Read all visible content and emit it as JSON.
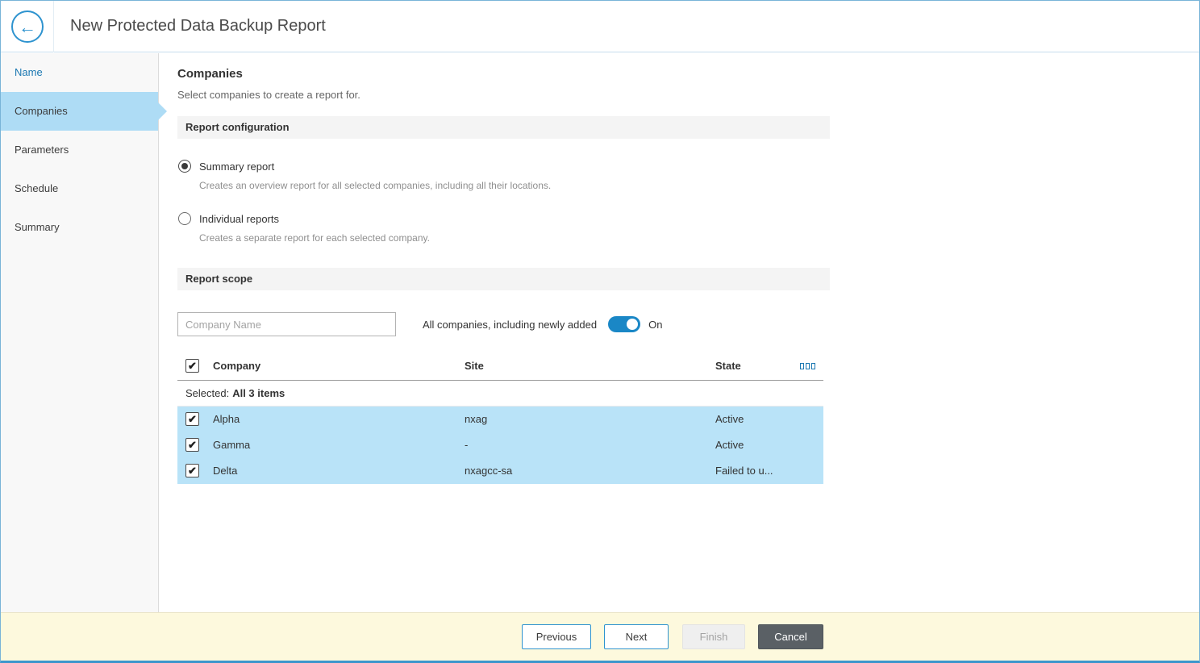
{
  "header": {
    "title": "New Protected Data Backup Report"
  },
  "sidebar": {
    "items": [
      {
        "label": "Name"
      },
      {
        "label": "Companies"
      },
      {
        "label": "Parameters"
      },
      {
        "label": "Schedule"
      },
      {
        "label": "Summary"
      }
    ]
  },
  "main": {
    "title": "Companies",
    "subtitle": "Select companies to create a report for.",
    "report_configuration": {
      "heading": "Report configuration",
      "options": [
        {
          "label": "Summary report",
          "description": "Creates an overview report for all selected companies, including all their locations.",
          "selected": true
        },
        {
          "label": "Individual reports",
          "description": "Creates a separate report for each selected company.",
          "selected": false
        }
      ]
    },
    "report_scope": {
      "heading": "Report scope",
      "filter_placeholder": "Company Name",
      "toggle_label": "All companies, including newly added",
      "toggle_state_label": "On",
      "table": {
        "columns": {
          "company": "Company",
          "site": "Site",
          "state": "State"
        },
        "selected_prefix": "Selected:",
        "selected_value": "All 3 items",
        "rows": [
          {
            "company": "Alpha",
            "site": "nxag",
            "state": "Active",
            "checked": true
          },
          {
            "company": "Gamma",
            "site": "-",
            "state": "Active",
            "checked": true
          },
          {
            "company": "Delta",
            "site": "nxagcc-sa",
            "state": "Failed to u...",
            "checked": true
          }
        ]
      }
    }
  },
  "footer": {
    "previous_label": "Previous",
    "next_label": "Next",
    "finish_label": "Finish",
    "cancel_label": "Cancel"
  },
  "icons": {
    "back": "←",
    "check": "✔"
  },
  "colors": {
    "accent": "#1a87c6",
    "sidebar_active": "#aedcf5",
    "row_highlight": "#b9e3f8",
    "footer_bg": "#fdf9dd"
  }
}
